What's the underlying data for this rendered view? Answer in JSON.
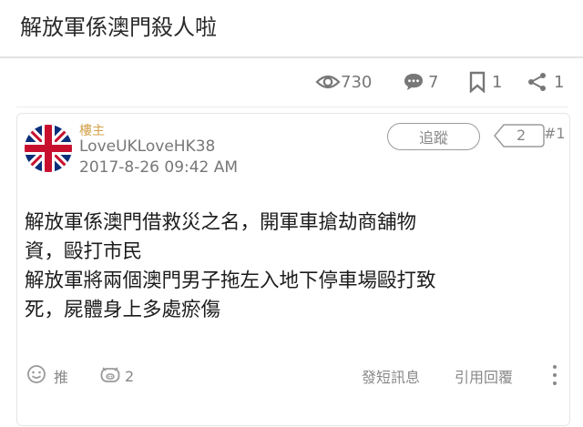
{
  "thread": {
    "title": "解放軍係澳門殺人啦"
  },
  "stats": {
    "views": "730",
    "comments": "7",
    "bookmarks": "1",
    "shares": "1"
  },
  "post": {
    "role": "樓主",
    "username": "LoveUKLoveHK38",
    "datetime": "2017-8-26 09:42 AM",
    "follow_label": "追蹤",
    "follow_count": "2",
    "floor": "#1",
    "body_lines": [
      "解放軍係澳門借救災之名，開軍車搶劫商舖物",
      "資，毆打市民",
      "解放軍將兩個澳門男子拖左入地下停車場毆打致",
      "死，屍體身上多處瘀傷"
    ],
    "actions": {
      "like_label": "推",
      "dislike_count": "2",
      "message_label": "發短訊息",
      "quote_label": "引用回覆"
    }
  },
  "colors": {
    "role_gold": "#d3a14a",
    "muted_grey": "#777777",
    "text_dark": "#1c1c1c"
  }
}
